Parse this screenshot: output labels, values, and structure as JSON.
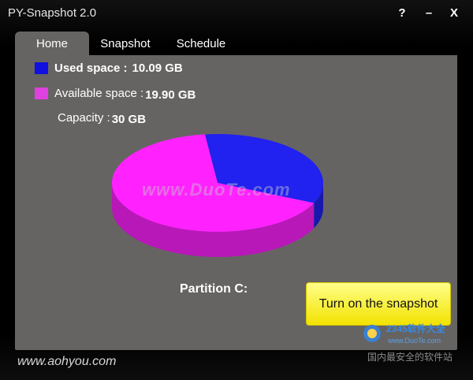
{
  "window": {
    "title": "PY-Snapshot 2.0",
    "controls": {
      "help": "?",
      "minimize": "–",
      "close": "X"
    }
  },
  "tabs": [
    {
      "label": "Home",
      "active": true
    },
    {
      "label": "Snapshot",
      "active": false
    },
    {
      "label": "Schedule",
      "active": false
    }
  ],
  "legend": {
    "used": {
      "label": "Used space :",
      "value": "10.09 GB",
      "color": "#1010e0"
    },
    "available": {
      "label": "Available space :",
      "value": "19.90 GB",
      "color": "#e040e0"
    },
    "capacity": {
      "label": "Capacity :",
      "value": "30 GB"
    }
  },
  "chart_data": {
    "type": "pie",
    "categories": [
      "Used space",
      "Available space"
    ],
    "values": [
      10.09,
      19.9
    ],
    "colors": [
      "#2121f0",
      "#ff22ff"
    ]
  },
  "watermark": "www.DuoTe.com",
  "partition_label": "Partition C:",
  "snapshot_button": "Turn on the snapshot",
  "footer": "www.aohyou.com",
  "site_badge": {
    "text": "2345软件大全",
    "url": "www.DuoTe.com",
    "tagline": "国内最安全的软件站"
  }
}
